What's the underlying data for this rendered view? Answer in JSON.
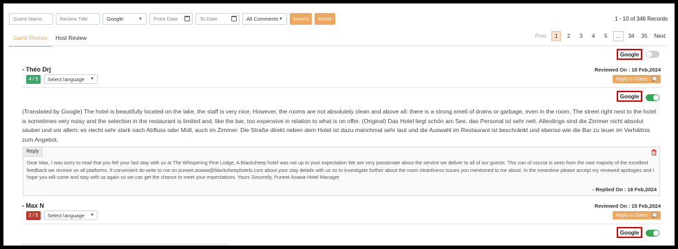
{
  "filters": {
    "guest_name_placeholder": "Guest Name",
    "review_title_placeholder": "Review Title",
    "source_value": "Google",
    "from_date_placeholder": "From Date",
    "to_date_placeholder": "To Date",
    "comments_value": "All Comments",
    "search_label": "Search",
    "reset_label": "Reset"
  },
  "records": "1 - 10 of 346 Records",
  "tabs": [
    {
      "label": "Guest Review",
      "active": true
    },
    {
      "label": "Host Review",
      "active": false
    }
  ],
  "pagination": {
    "prev": "Prev",
    "pages": [
      "1",
      "2",
      "3",
      "4",
      "5",
      "...",
      "34",
      "35"
    ],
    "next": "Next",
    "current": "1"
  },
  "reviews": [
    {
      "source": "Google",
      "toggle_on": false,
      "name": "- Théo Drj",
      "rating": "4 / 5",
      "language_placeholder": "Select language",
      "reviewed_on": "Reviewed On : 18 Feb,2024",
      "reply_button": "Reply to Guest - 💬"
    },
    {
      "source": "Google",
      "toggle_on": true,
      "text": "(Translated by Google) The hotel is beautifully located on the lake, the staff is very nice. However, the rooms are not absolutely clean and above all: there is a strong smell of drains or garbage, even in the room. The street right next to the hotel is sometimes very noisy and the selection in the restaurant is limited and, like the bar, too expensive in relation to what is on offer. (Original) Das Hotel liegt schön am See, das Personal ist sehr nett. Allerdings sind die Zimmer nicht absolut sauber und vor allem: es riecht sehr stark nach Abfluss oder Müll, auch im Zimmer. Die Straße direkt neben dem Hotel ist dazu manchmal sehr laut und die Auswahl im Restaurant ist beschränkt und ebenso wie die Bar zu teuer im Verhältnis zum Angebot.",
      "reply": {
        "label": "Reply",
        "text": "Dear Max, I was sorry to read that you felt your last stay with us at The Whispering Pine Lodge, A Blacksheep hotel was not up to your expectation We are very passionate about the service we deliver to all of our guests. This can of course is seen from the vast majority of the excellent feedback we receive on all platforms. If convenient do write to me on puneet.asawa@blacksheephotels.com about your stay details with us so to investigate further about the room cleanliness issues you mentioned to me about. In the meantime please accept my renewed apologies and I hope you will come and stay with us again so we can get the chance to meet your expectations. Yours Sincerely, Puneet Asawa Hotel Manager",
        "replied_on": "- Replied On : 18 Feb,2024"
      }
    },
    {
      "source": "Google",
      "toggle_on": true,
      "name": "- Max N",
      "rating": "2 / 5",
      "language_placeholder": "Select language",
      "reviewed_on": "Reviewed On : 15 Feb,2024",
      "reply_button": "Reply to Guest - 💬"
    }
  ],
  "colors": {
    "accent": "#f0a65c",
    "highlight_border": "#e00000",
    "toggle_on": "#34a853",
    "rating_good": "#3aa76d",
    "rating_bad": "#c0392b"
  }
}
